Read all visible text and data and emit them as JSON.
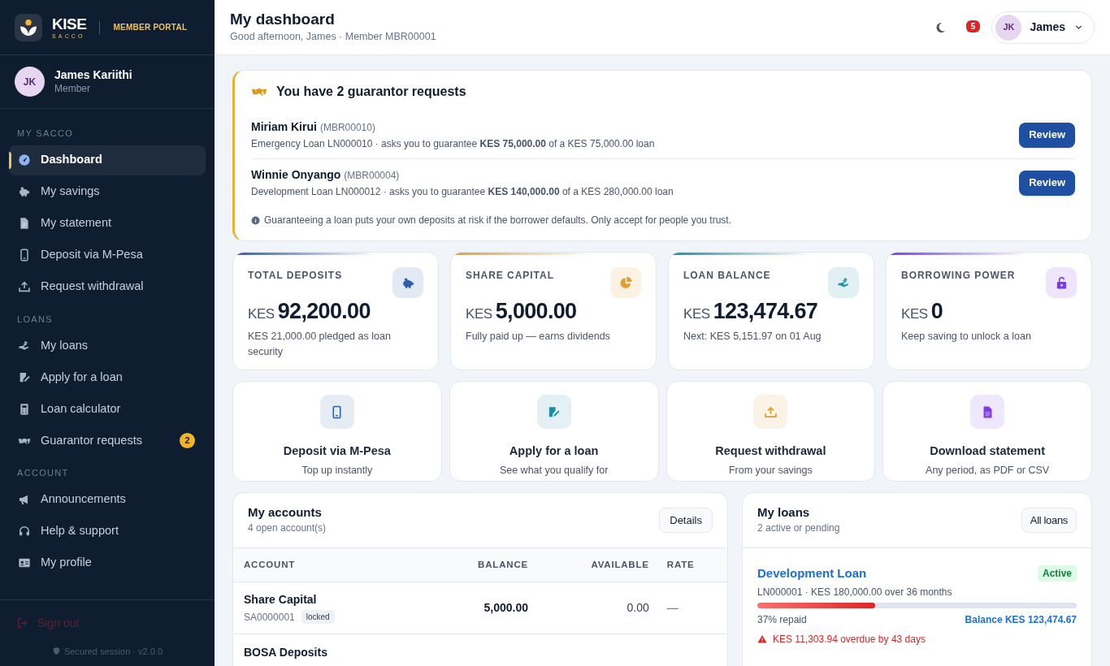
{
  "brand": {
    "name": "KISE",
    "sub": "SACCO",
    "portal": "MEMBER PORTAL"
  },
  "user": {
    "initials": "JK",
    "name": "James Kariithi",
    "role": "Member"
  },
  "sidebar": {
    "sections": [
      {
        "title": "MY SACCO",
        "items": [
          {
            "label": "Dashboard",
            "selected": true
          },
          {
            "label": "My savings",
            "selected": false
          },
          {
            "label": "My statement",
            "selected": false
          },
          {
            "label": "Deposit via M-Pesa",
            "selected": false
          },
          {
            "label": "Request withdrawal",
            "selected": false
          }
        ]
      },
      {
        "title": "LOANS",
        "items": [
          {
            "label": "My loans",
            "selected": false
          },
          {
            "label": "Apply for a loan",
            "selected": false
          },
          {
            "label": "Loan calculator",
            "selected": false
          },
          {
            "label": "Guarantor requests",
            "selected": false,
            "badge": "2"
          }
        ]
      },
      {
        "title": "ACCOUNT",
        "items": [
          {
            "label": "Announcements",
            "selected": false
          },
          {
            "label": "Help & support",
            "selected": false
          },
          {
            "label": "My profile",
            "selected": false
          }
        ]
      }
    ],
    "signout": "Sign out",
    "footer": "Secured session · v2.0.0"
  },
  "header": {
    "title": "My dashboard",
    "subtitle": "Good afternoon, James · Member MBR00001",
    "notifications": "5",
    "user_initials": "JK",
    "user_name": "James"
  },
  "guarantor": {
    "title": "You have 2 guarantor requests",
    "requests": [
      {
        "name": "Miriam Kirui",
        "id": "(MBR00010)",
        "detail": "Emergency Loan LN000010 · asks you to guarantee **KES 75,000.00** of a KES 75,000.00 loan",
        "action": "Review"
      },
      {
        "name": "Winnie Onyango",
        "id": "(MBR00004)",
        "detail": "Development Loan LN000012 · asks you to guarantee **KES 140,000.00** of a KES 280,000.00 loan",
        "action": "Review"
      }
    ],
    "note": "Guaranteeing a loan puts your own deposits at risk if the borrower defaults. Only accept for people you trust."
  },
  "stats": [
    {
      "label": "TOTAL DEPOSITS",
      "currency": "KES",
      "value": "92,200.00",
      "note": "KES 21,000.00 pledged as loan security"
    },
    {
      "label": "SHARE CAPITAL",
      "currency": "KES",
      "value": "5,000.00",
      "note": "Fully paid up — earns dividends"
    },
    {
      "label": "LOAN BALANCE",
      "currency": "KES",
      "value": "123,474.67",
      "note": "Next: KES 5,151.97 on 01 Aug"
    },
    {
      "label": "BORROWING POWER",
      "currency": "KES",
      "value": "0",
      "note": "Keep saving to unlock a loan"
    }
  ],
  "actions": [
    {
      "title": "Deposit via M-Pesa",
      "sub": "Top up instantly"
    },
    {
      "title": "Apply for a loan",
      "sub": "See what you qualify for"
    },
    {
      "title": "Request withdrawal",
      "sub": "From your savings"
    },
    {
      "title": "Download statement",
      "sub": "Any period, as PDF or CSV"
    }
  ],
  "accounts": {
    "title": "My accounts",
    "sub": "4 open account(s)",
    "button": "Details",
    "columns": [
      "ACCOUNT",
      "BALANCE",
      "AVAILABLE",
      "RATE"
    ],
    "rows": [
      {
        "name": "Share Capital",
        "number": "SA0000001",
        "tag": "locked",
        "balance": "5,000.00",
        "available": "0.00",
        "rate": "—"
      },
      {
        "name": "BOSA Deposits"
      }
    ]
  },
  "loans": {
    "title": "My loans",
    "sub": "2 active or pending",
    "button": "All loans",
    "items": [
      {
        "name": "Development Loan",
        "status": "Active",
        "detail": "LN000001 · KES 180,000.00 over 36 months",
        "level": 0.37,
        "repaid": "37% repaid",
        "balance": "Balance KES 123,474.67",
        "warning": "KES 11,303.94 overdue by 43 days"
      }
    ]
  }
}
